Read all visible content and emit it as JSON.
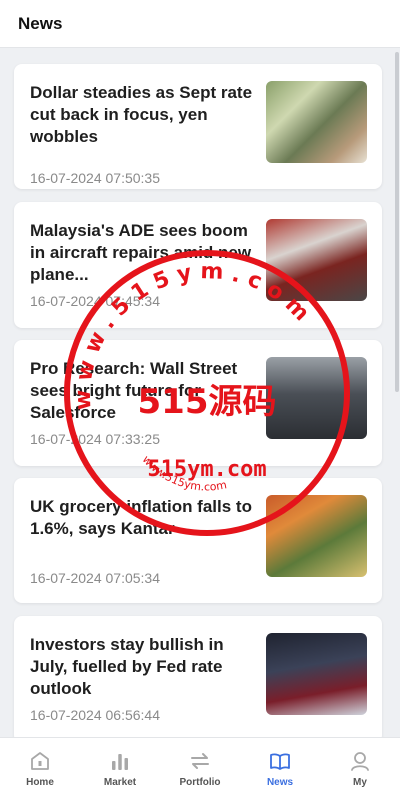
{
  "header": {
    "title": "News"
  },
  "articles": [
    {
      "title": "Dollar steadies as Sept rate cut back in focus, yen wobbles",
      "time": "16-07-2024 07:50:35"
    },
    {
      "title": "Malaysia's ADE sees boom in aircraft repairs amid new plane...",
      "time": "16-07-2024 07:45:34"
    },
    {
      "title": "Pro Research: Wall Street sees bright future for Salesforce",
      "time": "16-07-2024 07:33:25"
    },
    {
      "title": "UK grocery inflation falls to 1.6%, says Kantar",
      "time": "16-07-2024 07:05:34"
    },
    {
      "title": "Investors stay bullish in July, fuelled by Fed rate outlook",
      "time": "16-07-2024 06:56:44"
    }
  ],
  "watermark": {
    "ring_text": "w w w . 5 1 5 y m . c o m",
    "center_text": "515源码",
    "domain_text": "515ym.com",
    "small_text": "www.515ym.com",
    "color": "#e5141b"
  },
  "tabbar": {
    "tabs": [
      {
        "label": "Home",
        "icon": "home-icon"
      },
      {
        "label": "Market",
        "icon": "bar-chart-icon"
      },
      {
        "label": "Portfolio",
        "icon": "swap-arrows-icon"
      },
      {
        "label": "News",
        "icon": "open-book-icon"
      },
      {
        "label": "My",
        "icon": "user-icon"
      }
    ],
    "active": "News",
    "active_color": "#3b6fe0",
    "inactive_color": "#999999"
  }
}
